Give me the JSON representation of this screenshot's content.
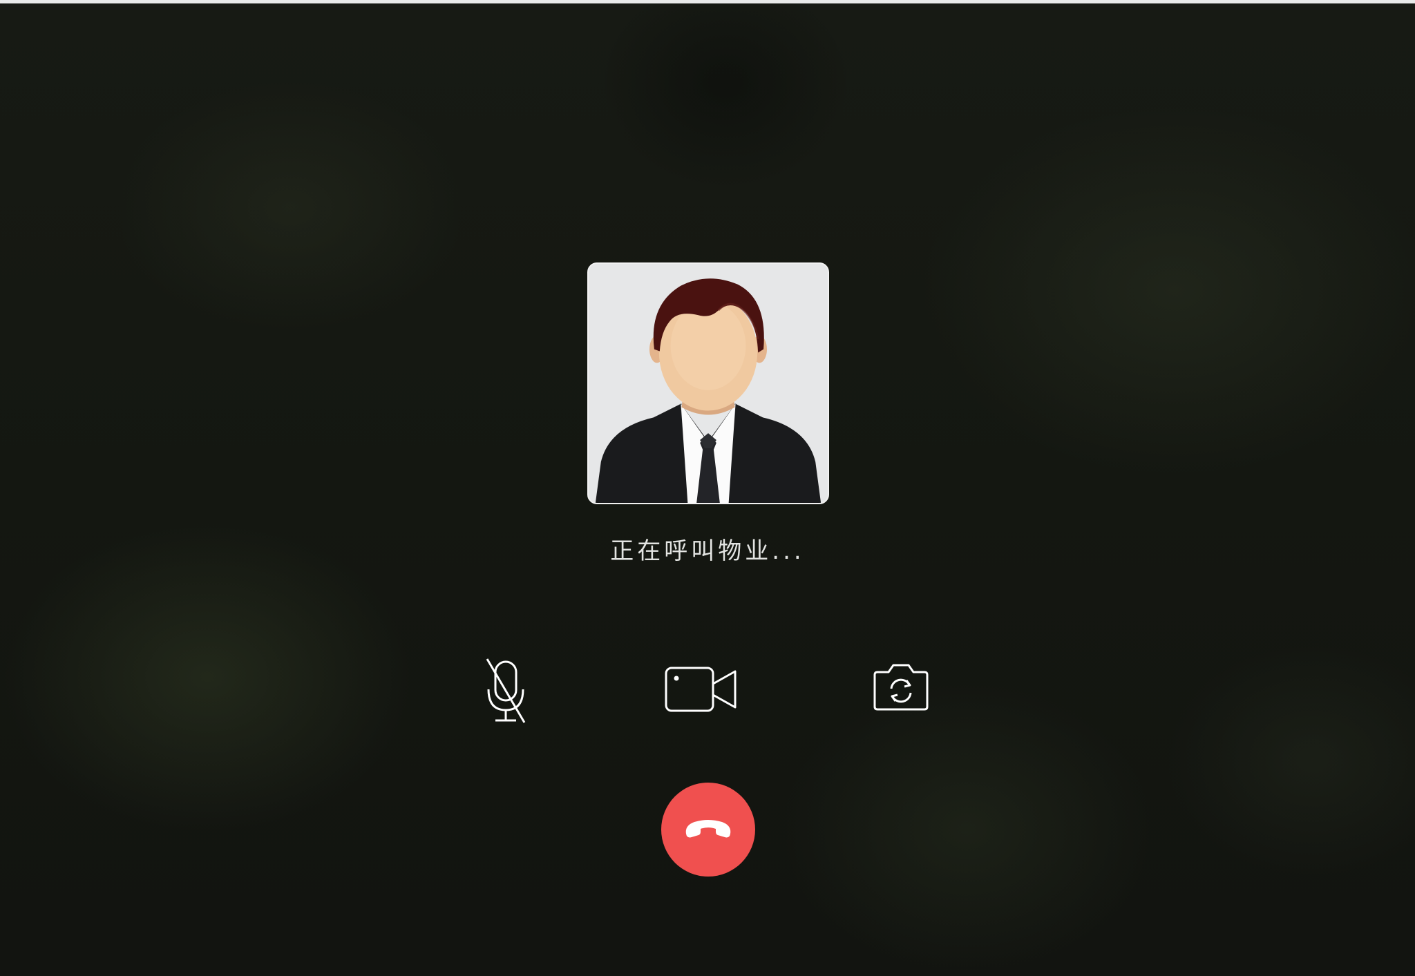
{
  "call": {
    "status_text": "正在呼叫物业...",
    "callee_avatar": "businessman-avatar"
  },
  "controls": {
    "mute": {
      "icon": "microphone-muted-icon",
      "state": "muted"
    },
    "video": {
      "icon": "video-camera-icon"
    },
    "switch_camera": {
      "icon": "camera-switch-icon"
    },
    "hangup": {
      "icon": "phone-hangup-icon",
      "color": "#f0504f"
    }
  },
  "colors": {
    "background": "#151812",
    "text": "#e3e4e2",
    "icon": "#ffffff",
    "hangup": "#f0504f"
  }
}
